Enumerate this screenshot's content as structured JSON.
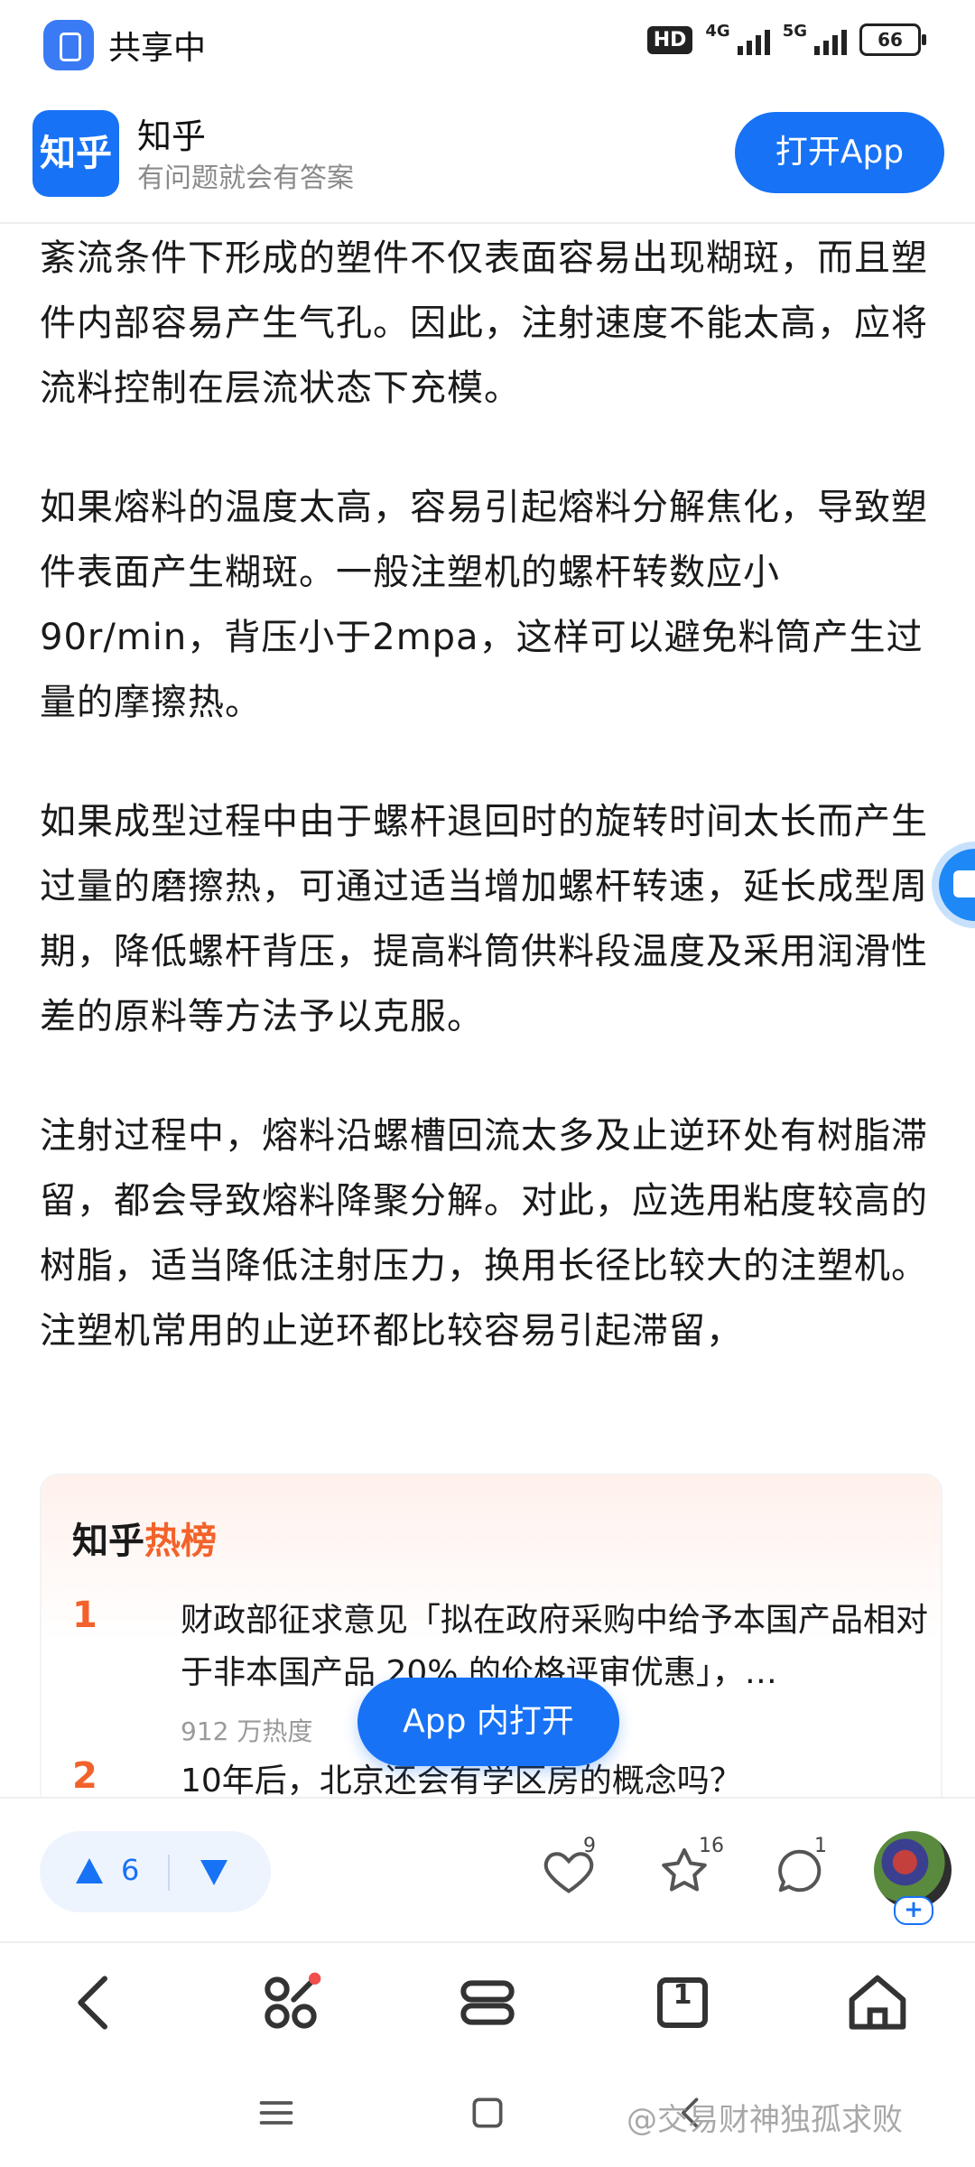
{
  "status_bar": {
    "share_label": "共享中",
    "hd_badge": "HD",
    "network_1": "4G",
    "network_2": "5G",
    "battery": "66"
  },
  "app_banner": {
    "app_icon_text": "知乎",
    "title": "知乎",
    "subtitle": "有问题就会有答案",
    "open_button": "打开App"
  },
  "article": {
    "paragraphs": [
      "紊流条件下形成的塑件不仅表面容易出现糊斑，而且塑件内部容易产生气孔。因此，注射速度不能太高，应将流料控制在层流状态下充模。",
      "如果熔料的温度太高，容易引起熔料分解焦化，导致塑件表面产生糊斑。一般注塑机的螺杆转数应小90r/min，背压小于2mpa，这样可以避免料筒产生过量的摩擦热。",
      "如果成型过程中由于螺杆退回时的旋转时间太长而产生过量的磨擦热，可通过适当增加螺杆转速，延长成型周期，降低螺杆背压，提高料筒供料段温度及采用润滑性差的原料等方法予以克服。",
      "注射过程中，熔料沿螺槽回流太多及止逆环处有树脂滞留，都会导致熔料降聚分解。对此，应选用粘度较高的树脂，适当降低注射压力，换用长径比较大的注塑机。注塑机常用的止逆环都比较容易引起滞留，"
    ]
  },
  "hot_list": {
    "title_prefix": "知乎",
    "title_suffix": "热榜",
    "items": [
      {
        "rank": "1",
        "text": "财政部征求意见「拟在政府采购中给予本国产品相对于非本国产品 20% 的价格评审优惠」，…",
        "heat": "912 万热度"
      },
      {
        "rank": "2",
        "text": "10年后，北京还会有学区房的概念吗？",
        "heat": ""
      }
    ]
  },
  "app_open_pill": "App 内打开",
  "action_bar": {
    "upvotes": "6",
    "like_count": "9",
    "favorite_count": "16",
    "comment_count": "1",
    "follow_plus": "+"
  },
  "browser_nav": {
    "tab_count": "1"
  },
  "watermark": "@交易财神独孤求败",
  "colors": {
    "brand": "#1772f6",
    "hot": "#f2622a"
  }
}
